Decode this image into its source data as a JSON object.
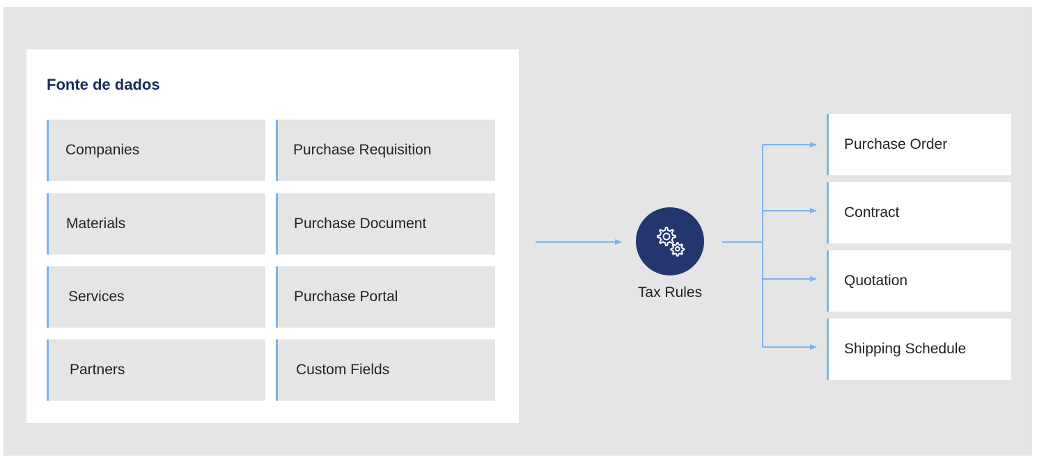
{
  "panel": {
    "title": "Fonte de dados",
    "sources_left": [
      "Companies",
      "Materials",
      "Services",
      "Partners"
    ],
    "sources_right": [
      "Purchase Requisition",
      "Purchase Document",
      "Purchase Portal",
      "Custom Fields"
    ]
  },
  "hub": {
    "label": "Tax Rules",
    "icon": "gears-icon"
  },
  "outputs": [
    "Purchase Order",
    "Contract",
    "Quotation",
    "Shipping Schedule"
  ],
  "colors": {
    "background": "#e5e5e5",
    "title": "#1a2b5b",
    "accent": "#7cb3ec",
    "hub": "#23366e"
  }
}
